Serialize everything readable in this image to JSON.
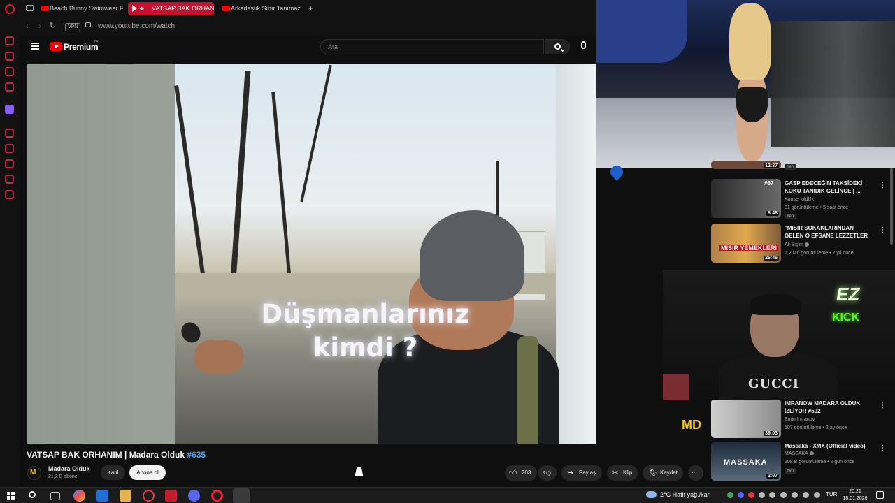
{
  "browser": {
    "tabs": [
      {
        "label": "Beach Bunny Swimwear F",
        "active": false
      },
      {
        "label": "VATSAP BAK ORHANI",
        "active": true
      },
      {
        "label": "Arkadaşlık Sınır Tanımaz M",
        "active": false
      }
    ],
    "new_tab_label": "+",
    "vpn_label": "VPN",
    "url": "www.youtube.com/watch"
  },
  "youtube": {
    "brand": "Premium",
    "brand_sup": "TR",
    "search_placeholder": "Ara"
  },
  "video": {
    "caption_line1": "Düşmanlarınız",
    "caption_line2": "kimdi ?",
    "title": "VATSAP BAK ORHANIM | Madara Olduk ",
    "hashtag": "#635",
    "watermark": "MD"
  },
  "channel": {
    "avatar_letters": "M",
    "name": "Madara Olduk",
    "subscribers": "21,2 B abone",
    "join_label": "Katıl",
    "subscribe_label": "Abone ol"
  },
  "actions": {
    "likes": "203",
    "share": "Paylaş",
    "clip": "Klip",
    "save": "Kaydet",
    "more": "···"
  },
  "recommendations": [
    {
      "title": "",
      "channel": "",
      "meta": "",
      "duration": "12:37",
      "badge": "Yeni"
    },
    {
      "title": "GASP EDECEĞİN TAKSİDEKİ KOKU TANIDIK GELİNCE | ...",
      "channel": "Kanser oldUk",
      "meta": "81 görüntüleme • 5 saat önce",
      "duration": "8:48",
      "badge": "Yeni",
      "thumb_text": "#67"
    },
    {
      "title": "\"MISIR SOKAKLARINDAN GELEN O EFSANE LEZZETLER ...",
      "channel": "Ali Biçim",
      "meta": "1,2 Mn görüntüleme • 2 yıl önce",
      "duration": "26:46",
      "badge": "",
      "thumb_text": "MISIR YEMEKLERİ"
    },
    {
      "title": "IMRANOW MADARA OLDUK İZLİYOR #592",
      "channel": "Emin İmranov",
      "meta": "107 görüntüleme • 2 ay önce",
      "duration": "39:03",
      "badge": ""
    },
    {
      "title": "Massaka - XMX (Official video)",
      "channel": "MASSAKA",
      "meta": "308 B görüntüleme • 2 gün önce",
      "duration": "2:07",
      "badge": "Yeni",
      "thumb_text": "MASSAKA"
    }
  ],
  "webcam": {
    "overlay_ez": "EZ",
    "overlay_kick": "KICK",
    "shirt_text": "GUCCI"
  },
  "taskbar": {
    "weather": "2°C  Hafif yağ./kar",
    "language": "TUR",
    "time": "20:21",
    "date": "18.01.2026"
  },
  "colors": {
    "opera_red": "#c8102e",
    "youtube_red": "#ff0000",
    "kick_green": "#53fc18",
    "hashtag_blue": "#3ea6ff"
  }
}
